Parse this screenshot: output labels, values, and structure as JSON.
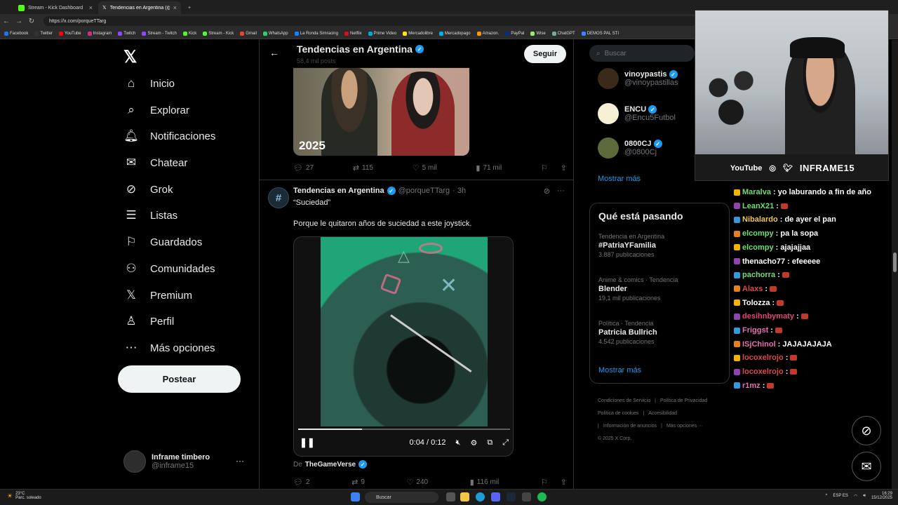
{
  "browser": {
    "tabs": [
      {
        "label": "Stream - Kick Dashboard",
        "active": false
      },
      {
        "label": "Tendencias en Argentina (@porq",
        "active": true
      }
    ],
    "url": "https://x.com/porqueTTarg",
    "bookmarks": [
      "Facebook",
      "Twitter",
      "YouTube",
      "Instagram",
      "Twitch",
      "Stream - Twitch",
      "Kick",
      "Stream - Kick",
      "Gmail",
      "WhatsApp",
      "La Ronda Simracing",
      "Netflix",
      "Prime Video",
      "Mercadolibre",
      "Mercadopago",
      "Amazon.",
      "PayPal",
      "Wise",
      "ChatGPT",
      "DEMOS PAL STI"
    ]
  },
  "nav": {
    "items": [
      {
        "label": "Inicio",
        "icon": "home-icon",
        "glyph": "⌂"
      },
      {
        "label": "Explorar",
        "icon": "search-icon",
        "glyph": "⌕"
      },
      {
        "label": "Notificaciones",
        "icon": "bell-icon",
        "glyph": "🔔︎"
      },
      {
        "label": "Chatear",
        "icon": "mail-icon",
        "glyph": "✉"
      },
      {
        "label": "Grok",
        "icon": "grok-icon",
        "glyph": "⊘"
      },
      {
        "label": "Listas",
        "icon": "list-icon",
        "glyph": "☰"
      },
      {
        "label": "Guardados",
        "icon": "bookmark-icon",
        "glyph": "⚐"
      },
      {
        "label": "Comunidades",
        "icon": "people-icon",
        "glyph": "⚇"
      },
      {
        "label": "Premium",
        "icon": "x-icon",
        "glyph": "𝕏"
      },
      {
        "label": "Perfil",
        "icon": "person-icon",
        "glyph": "♙"
      },
      {
        "label": "Más opciones",
        "icon": "more-icon",
        "glyph": "⋯"
      }
    ],
    "post_label": "Postear",
    "profile": {
      "name": "Inframe timbero",
      "handle": "@inframe15"
    }
  },
  "header": {
    "title": "Tendencias en Argentina",
    "posts": "58,4 mil posts",
    "follow": "Seguir"
  },
  "post1": {
    "image_caption": "2025",
    "actions": {
      "replies": "27",
      "reposts": "115",
      "likes": "5 mil",
      "views": "71 mil"
    }
  },
  "post2": {
    "author": "Tendencias en Argentina",
    "handle": "@porqueTTarg",
    "time": "· 3h",
    "text1": "“Suciedad”",
    "text2": "Porque le quitaron años de suciedad a este joystick.",
    "video": {
      "time": "0:04 / 0:12",
      "progress": 0.3
    },
    "source_prefix": "De",
    "source": "TheGameVerse",
    "actions": {
      "replies": "2",
      "reposts": "9",
      "likes": "240",
      "views": "116 mil"
    }
  },
  "right": {
    "search_placeholder": "Buscar",
    "suggestions": [
      {
        "name": "vinoypastis",
        "handle": "@vinoypastillas",
        "color": "#3a2a1a"
      },
      {
        "name": "ENCU",
        "handle": "@Encu5Futbol",
        "color": "#f5f0d6"
      },
      {
        "name": "0800CJ",
        "handle": "@0800Cj",
        "color": "#5a6a3a"
      }
    ],
    "show_more": "Mostrar más",
    "trends_title": "Qué está pasando",
    "trends": [
      {
        "context": "Tendencia en Argentina",
        "title": "#PatriaYFamilia",
        "count": "3.887 publicaciones"
      },
      {
        "context": "Anime & comics · Tendencia",
        "title": "Blender",
        "count": "19,1 mil publicaciones"
      },
      {
        "context": "Política · Tendencia",
        "title": "Patricia Bullrich",
        "count": "4.542 publicaciones"
      }
    ],
    "trends_more": "Mostrar más",
    "footer": [
      "Condiciones de Servicio",
      "|",
      "Política de Privacidad",
      "Política de cookies",
      "|",
      "Accesibilidad",
      "|",
      "Información de anuncios",
      "|",
      "Más opciones ···",
      "© 2025 X Corp."
    ]
  },
  "cam": {
    "youtube": "YouTube",
    "brand": "INFRAME15"
  },
  "chat": [
    {
      "user": "Maralva",
      "msg": ": yo laburando a fin de año",
      "color": "#6fe06f"
    },
    {
      "user": "LeanX21",
      "msg": ":",
      "color": "#6fe06f",
      "emote": true
    },
    {
      "user": "Nibalardo",
      "msg": ": de ayer el pan",
      "color": "#f0c75e"
    },
    {
      "user": "elcompy",
      "msg": ": pa la sopa",
      "color": "#6fe06f"
    },
    {
      "user": "elcompy",
      "msg": ": ajajajjaa",
      "color": "#6fe06f"
    },
    {
      "user": "thenacho77",
      "msg": ": efeeeee",
      "color": "#ffffff"
    },
    {
      "user": "pachorra",
      "msg": ":",
      "color": "#6fe06f",
      "emote": true
    },
    {
      "user": "Alaxs",
      "msg": ":",
      "color": "#e04a4a",
      "emote": true
    },
    {
      "user": "Tolozza",
      "msg": ":",
      "color": "#ffffff",
      "emote": true
    },
    {
      "user": "desihnbymaty",
      "msg": ":",
      "color": "#e0457a",
      "emote": true
    },
    {
      "user": "Friggst",
      "msg": ":",
      "color": "#e66fb0",
      "emote": true
    },
    {
      "user": "ISjChinol",
      "msg": ": JAJAJAJAJA",
      "color": "#e66fb0"
    },
    {
      "user": "locoxelrojo",
      "msg": ":",
      "color": "#e04a4a",
      "emote": true
    },
    {
      "user": "locoxelrojo",
      "msg": ":",
      "color": "#e04a4a",
      "emote": true
    },
    {
      "user": "r1mz",
      "msg": ":",
      "color": "#e66fb0",
      "emote": true
    }
  ],
  "taskbar": {
    "temp": "23°C",
    "weather": "Parc. soleado",
    "search": "Buscar",
    "lang": "ESP ES",
    "time": "16:29",
    "date": "15/12/2025"
  }
}
